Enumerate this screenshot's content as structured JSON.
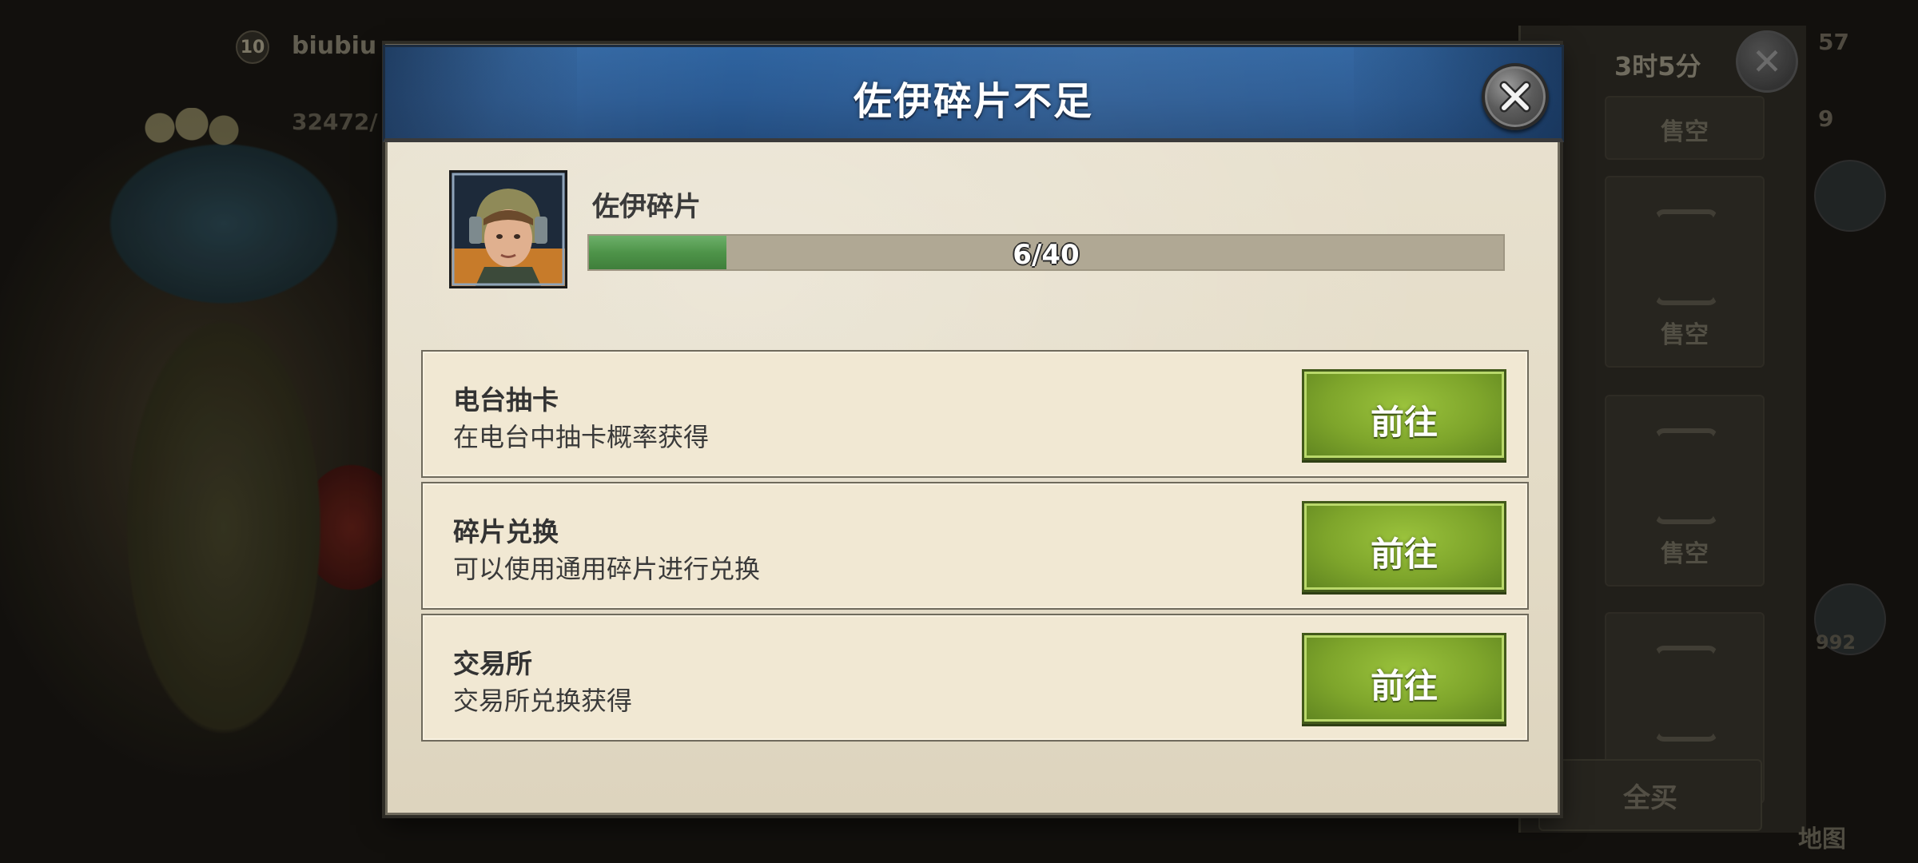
{
  "background": {
    "player_level": "10",
    "player_name": "biubiu",
    "player_power": "32472/",
    "shop_timer": "3时5分",
    "shop_close_glyph": "✕",
    "shop_slot_status": "售空",
    "shop_buy_all": "全买",
    "map_label": "地图",
    "side_numbers": [
      "57",
      "9",
      "992"
    ]
  },
  "dialog": {
    "title": "佐伊碎片不足",
    "close_icon": "close-icon",
    "hero": {
      "name": "佐伊碎片",
      "progress_text": "6/40",
      "current": 6,
      "required": 40,
      "progress_fraction": 0.15
    },
    "sources": [
      {
        "title": "电台抽卡",
        "desc": "在电台中抽卡概率获得",
        "button": "前往"
      },
      {
        "title": "碎片兑换",
        "desc": "可以使用通用碎片进行兑换",
        "button": "前往"
      },
      {
        "title": "交易所",
        "desc": "交易所兑换获得",
        "button": "前往"
      }
    ]
  },
  "colors": {
    "header_blue": "#2a5a93",
    "parchment": "#e6dfcc",
    "button_green": "#7ea52b",
    "progress_green": "#4e9449"
  }
}
